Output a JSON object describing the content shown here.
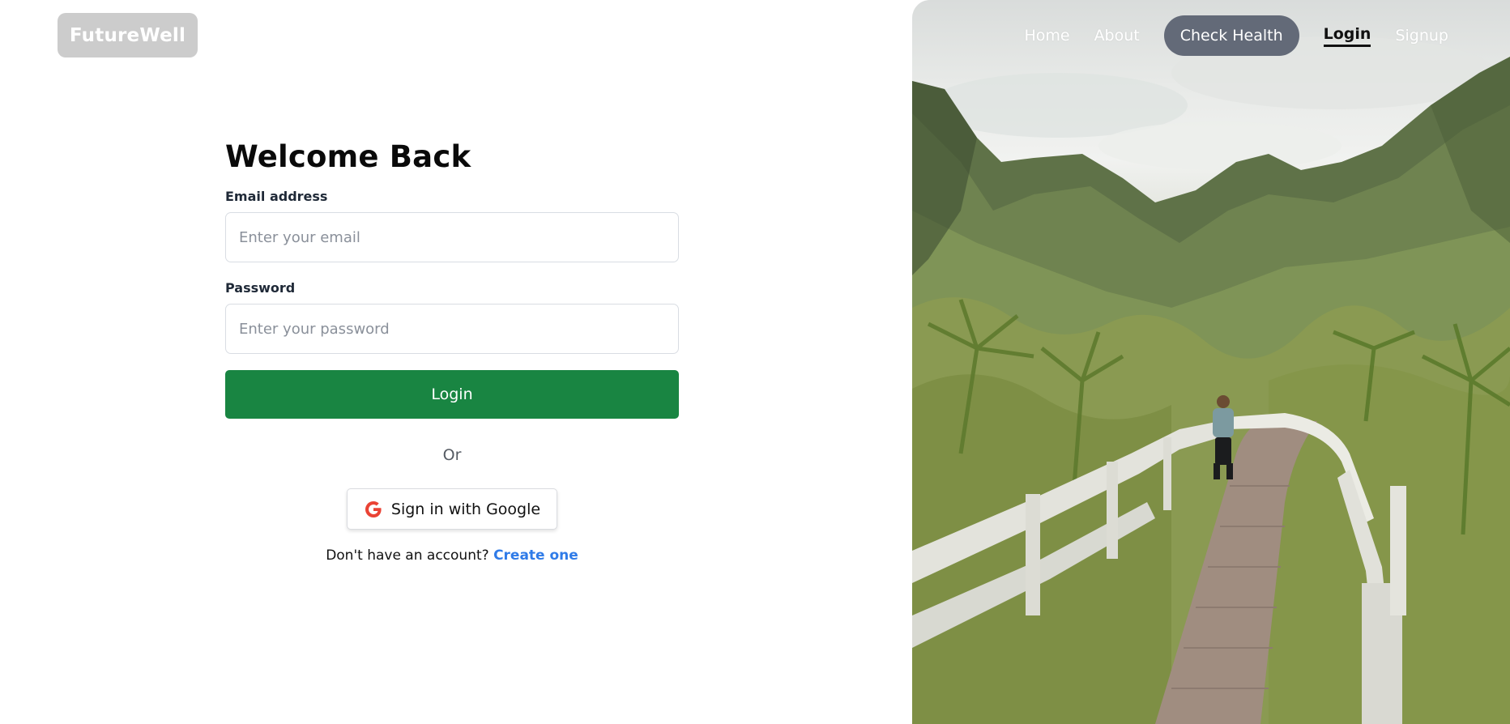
{
  "brand": {
    "name": "FutureWell"
  },
  "nav": {
    "home": "Home",
    "about": "About",
    "check_health": "Check Health",
    "login": "Login",
    "signup": "Signup"
  },
  "form": {
    "title": "Welcome Back",
    "email_label": "Email address",
    "email_placeholder": "Enter your email",
    "email_value": "",
    "password_label": "Password",
    "password_placeholder": "Enter your password",
    "password_value": "",
    "login_button": "Login",
    "divider": "Or",
    "google_button": "Sign in with Google",
    "signup_prompt": "Don't have an account?",
    "signup_link": "Create one"
  },
  "colors": {
    "primary_green": "#198542",
    "nav_cta_bg": "#636a78",
    "link_blue": "#2f7be8",
    "logo_bg": "#cccccc"
  },
  "icons": {
    "google": "google-g-icon",
    "hero": "hiking-boardwalk-photo"
  }
}
